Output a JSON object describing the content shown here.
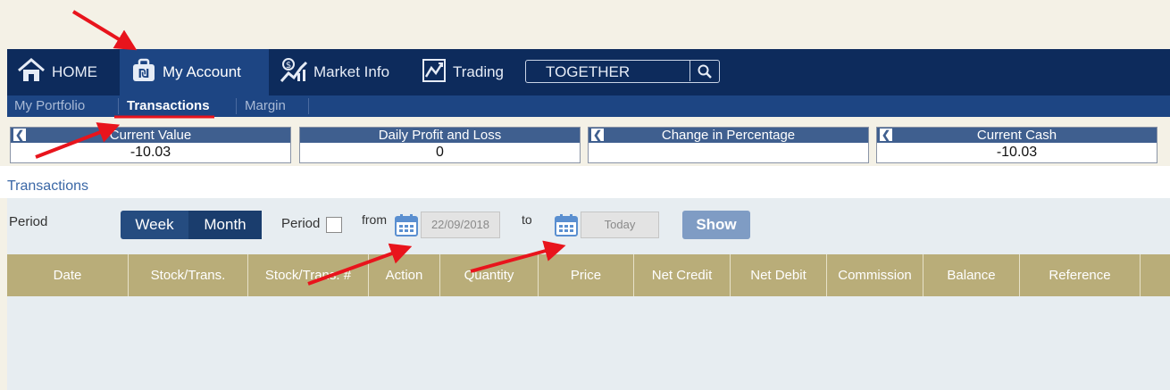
{
  "nav": {
    "items": [
      {
        "label": "HOME",
        "icon": "home-icon"
      },
      {
        "label": "My Account",
        "icon": "briefcase-icon"
      },
      {
        "label": "Market Info",
        "icon": "market-info-icon"
      },
      {
        "label": "Trading",
        "icon": "trading-chart-icon"
      }
    ],
    "search_value": "TOGETHER"
  },
  "subnav": {
    "items": [
      "My Portfolio",
      "Transactions",
      "Margin"
    ]
  },
  "summary": [
    {
      "title": "Current Value",
      "value": "-10.03"
    },
    {
      "title": "Daily Profit and Loss",
      "value": "0"
    },
    {
      "title": "Change in Percentage",
      "value": ""
    },
    {
      "title": "Current Cash",
      "value": "-10.03"
    }
  ],
  "section_title": "Transactions",
  "filters": {
    "period_label": "Period",
    "week_label": "Week",
    "month_label": "Month",
    "period_check_label": "Period",
    "from_label": "from",
    "from_date": "22/09/2018",
    "to_label": "to",
    "to_date": "Today",
    "show_label": "Show"
  },
  "table": {
    "columns": [
      "Date",
      "Stock/Trans.",
      "Stock/Trans. #",
      "Action",
      "Quantity",
      "Price",
      "Net Credit",
      "Net Debit",
      "Commission",
      "Balance",
      "Reference"
    ]
  },
  "colors": {
    "nav_bg": "#0d2b5c",
    "active_tab": "#1d4583",
    "table_header": "#b9ad79",
    "annotation_arrow": "#e8141c"
  }
}
